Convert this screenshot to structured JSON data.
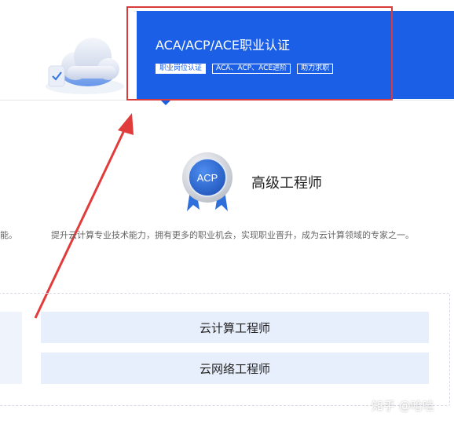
{
  "panel": {
    "title": "ACA/ACP/ACE职业认证",
    "tags": [
      "职业岗位认证",
      "ACA、ACP、ACE进阶",
      "助力求职"
    ]
  },
  "acp": {
    "badge_text": "ACP",
    "title": "高级工程师",
    "desc_left": "能。",
    "description": "提升云计算专业技术能力，拥有更多的职业机会，实现职业晋升，成为云计算领域的专家之一。"
  },
  "jobs": [
    "云计算工程师",
    "云网络工程师"
  ],
  "watermark": "知乎 @哈哇",
  "colors": {
    "panel_blue": "#1a5fe5",
    "highlight_red": "#d93a3a",
    "job_bg": "#e8effc"
  },
  "icons": [
    "cloud-check-icon",
    "acp-medal-icon",
    "annotation-arrow-icon"
  ]
}
